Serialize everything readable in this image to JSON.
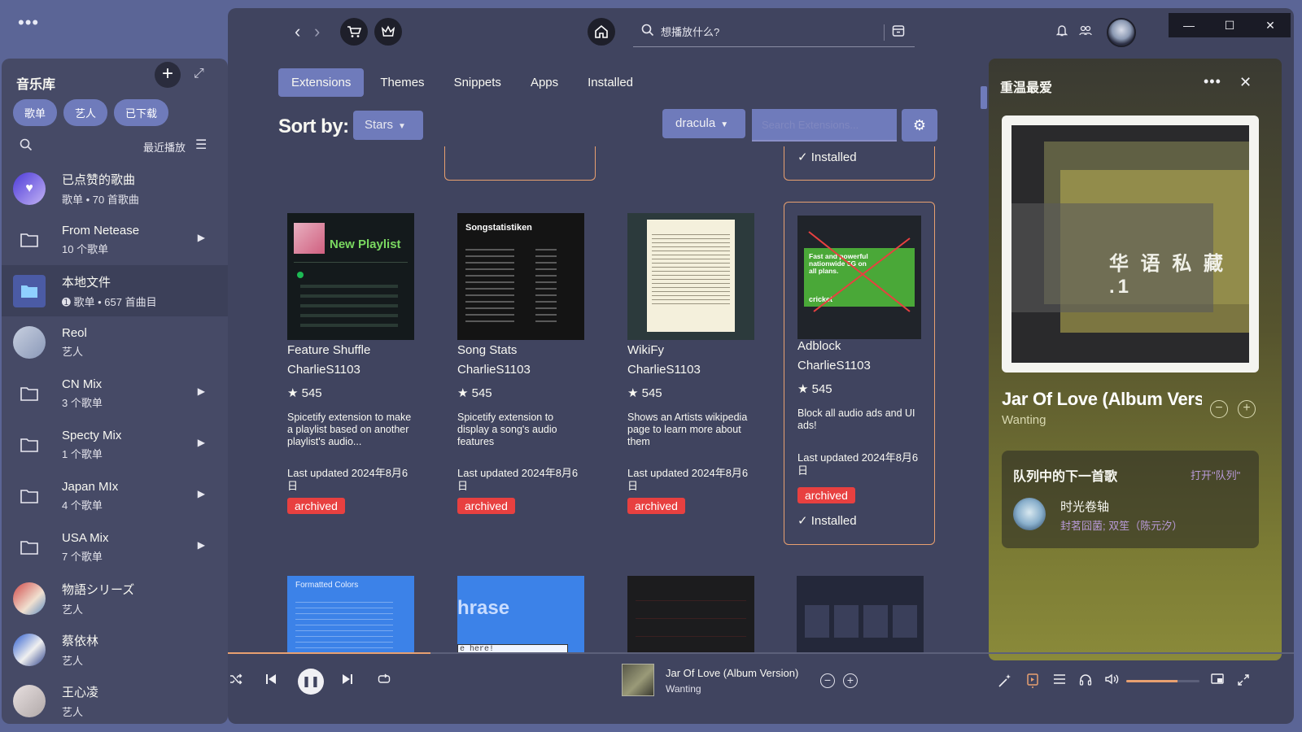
{
  "window": {
    "menu_dots": "•••",
    "minimize": "—",
    "maximize": "☐",
    "close": "✕"
  },
  "library": {
    "title": "音乐库",
    "add": "+",
    "expand": "⤢",
    "chips": [
      "歌单",
      "艺人",
      "已下载"
    ],
    "recent_label": "最近播放",
    "items": [
      {
        "name": "已点赞的歌曲",
        "sub": "歌单 • 70 首歌曲",
        "type": "liked",
        "arrow": ""
      },
      {
        "name": "From Netease",
        "sub": "10 个歌单",
        "type": "folder",
        "arrow": "▶"
      },
      {
        "name": "本地文件",
        "sub": "➊ 歌单 • 657 首曲目",
        "type": "local",
        "arrow": ""
      },
      {
        "name": "Reol",
        "sub": "艺人",
        "type": "reol",
        "arrow": ""
      },
      {
        "name": "CN Mix",
        "sub": "3 个歌单",
        "type": "folder",
        "arrow": "▶"
      },
      {
        "name": "Specty Mix",
        "sub": "1 个歌单",
        "type": "folder",
        "arrow": "▶"
      },
      {
        "name": "Japan MIx",
        "sub": "4 个歌单",
        "type": "folder",
        "arrow": "▶"
      },
      {
        "name": "USA Mix",
        "sub": "7 个歌单",
        "type": "folder",
        "arrow": "▶"
      },
      {
        "name": "物語シリーズ",
        "sub": "艺人",
        "type": "mono",
        "arrow": ""
      },
      {
        "name": "蔡依林",
        "sub": "艺人",
        "type": "tsai",
        "arrow": ""
      },
      {
        "name": "王心凌",
        "sub": "艺人",
        "type": "wang",
        "arrow": ""
      }
    ]
  },
  "header": {
    "search_placeholder": "想播放什么?",
    "back": "‹",
    "forward": "›"
  },
  "marketplace": {
    "tabs": [
      "Extensions",
      "Themes",
      "Snippets",
      "Apps",
      "Installed"
    ],
    "active_tab": 0,
    "sort_label": "Sort by:",
    "sort_value": "Stars",
    "theme_value": "dracula",
    "search_placeholder": "Search Extensions...",
    "partial_installed": "✓ Installed",
    "cards": [
      {
        "title": "Feature Shuffle",
        "author": "CharlieS1103",
        "stars": "★ 545",
        "desc": "Spicetify extension to make a playlist based on another playlist's audio...",
        "updated": "Last updated 2024年8月6日",
        "badge": "archived",
        "installed": ""
      },
      {
        "title": "Song Stats",
        "author": "CharlieS1103",
        "stars": "★ 545",
        "desc": "Spicetify extension to display a song's audio features",
        "updated": "Last updated 2024年8月6日",
        "badge": "archived",
        "installed": ""
      },
      {
        "title": "WikiFy",
        "author": "CharlieS1103",
        "stars": "★ 545",
        "desc": "Shows an Artists wikipedia page to learn more about them",
        "updated": "Last updated 2024年8月6日",
        "badge": "archived",
        "installed": ""
      },
      {
        "title": "Adblock",
        "author": "CharlieS1103",
        "stars": "★ 545",
        "desc": "Block all audio ads and UI ads!",
        "updated": "Last updated 2024年8月6日",
        "badge": "archived",
        "installed": "✓ Installed"
      }
    ],
    "thumb_text": {
      "new_playlist": "New Playlist",
      "songstats_title": "Songstatistiken",
      "adblock_promo": "Fast and powerful nationwide 5G on all plans.",
      "adblock_brand": "cricket",
      "formatted_colors": "Formatted Colors",
      "phrase": "hrase",
      "phrase_input": "e here!"
    }
  },
  "now_playing": {
    "panel_title": "重温最爱",
    "more": "•••",
    "close": "✕",
    "cover_text": "华 语 私 藏 .1",
    "song": "Jar Of Love (Album Version)",
    "artist": "Wanting",
    "queue_title": "队列中的下一首歌",
    "queue_open": "打开\"队列\"",
    "next_song": "时光卷轴",
    "next_artist": "封茗囧菌; 双笙（陈元汐）"
  },
  "player": {
    "song": "Jar Of Love (Album Version)",
    "artist": "Wanting",
    "progress": 0.19,
    "volume": 0.7
  },
  "colors": {
    "accent": "#6f7bbb",
    "highlight": "#e8a070",
    "badge": "#e84040"
  }
}
